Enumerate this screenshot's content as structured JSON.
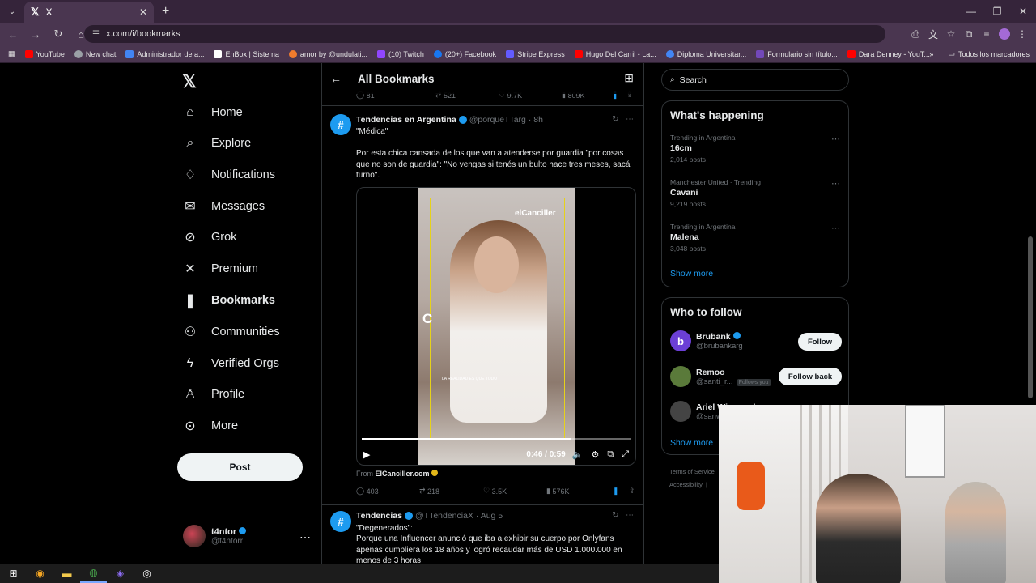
{
  "browser": {
    "tab_title": "X",
    "url": "x.com/i/bookmarks",
    "bookmarks": [
      {
        "label": "YouTube",
        "color": "#ff0000"
      },
      {
        "label": "New chat",
        "color": "#9aa0a6"
      },
      {
        "label": "Administrador de a...",
        "color": "#4285f4"
      },
      {
        "label": "EnBox | Sistema",
        "color": "#ffffff"
      },
      {
        "label": "amor by @undulati...",
        "color": "#f07b2d"
      },
      {
        "label": "(10) Twitch",
        "color": "#9146ff"
      },
      {
        "label": "(20+) Facebook",
        "color": "#1877f2"
      },
      {
        "label": "Stripe Express",
        "color": "#635bff"
      },
      {
        "label": "Hugo Del Carril - La...",
        "color": "#ff0000"
      },
      {
        "label": "Diploma Universitar...",
        "color": "#4285f4"
      },
      {
        "label": "Formulario sin título...",
        "color": "#7248b9"
      },
      {
        "label": "Dara Denney - YouT...",
        "color": "#ff0000"
      }
    ],
    "all_bookmarks": "Todos los marcadores"
  },
  "sidebar": {
    "items": [
      {
        "label": "Home",
        "icon": "⌂"
      },
      {
        "label": "Explore",
        "icon": "⌕"
      },
      {
        "label": "Notifications",
        "icon": "🔔"
      },
      {
        "label": "Messages",
        "icon": "✉"
      },
      {
        "label": "Grok",
        "icon": "⊘"
      },
      {
        "label": "Premium",
        "icon": "✕"
      },
      {
        "label": "Bookmarks",
        "icon": "❚"
      },
      {
        "label": "Communities",
        "icon": "👥"
      },
      {
        "label": "Verified Orgs",
        "icon": "⚡"
      },
      {
        "label": "Profile",
        "icon": "👤"
      },
      {
        "label": "More",
        "icon": "⋯"
      }
    ],
    "post_label": "Post",
    "user": {
      "name": "t4ntor",
      "handle": "@t4ntorr"
    }
  },
  "feed": {
    "title": "All Bookmarks",
    "prev_stats": {
      "replies": "81",
      "reposts": "521",
      "likes": "9.7K",
      "views": "809K"
    },
    "tweet1": {
      "name": "Tendencias en Argentina",
      "handle": "@porqueTTarg",
      "time": "· 8h",
      "line1": "\"Médica\"",
      "body": "Por esta chica cansada de los que van a atenderse por guardia \"por cosas que no son de guardia\": \"No vengas si tenés un bulto hace tres meses, sacá turno\".",
      "video": {
        "watermark": "elCanciller",
        "caption": "LA REALIDAD ES QUE TODO",
        "letter": "C",
        "time": "0:46 / 0:59",
        "progress": 0.78
      },
      "from_label": "From",
      "from_source": "ElCanciller.com",
      "replies": "403",
      "reposts": "218",
      "likes": "3.5K",
      "views": "576K"
    },
    "tweet2": {
      "name": "Tendencias",
      "handle": "@TTendenciaX",
      "time": "· Aug 5",
      "line1": "\"Degenerados\":",
      "body": "Porque una Influencer anunció que iba a exhibir su cuerpo por Onlyfans apenas cumpliera los 18 años y logró recaudar más de USD 1.000.000 en menos de 3 horas"
    }
  },
  "right": {
    "search_placeholder": "Search",
    "whats_happening": "What's happening",
    "trends": [
      {
        "context": "Trending in Argentina",
        "topic": "16cm",
        "count": "2,014 posts"
      },
      {
        "context": "Manchester United · Trending",
        "topic": "Cavani",
        "count": "9,219 posts"
      },
      {
        "context": "Trending in Argentina",
        "topic": "Malena",
        "count": "3,048 posts"
      }
    ],
    "show_more": "Show more",
    "who_to_follow": "Who to follow",
    "follows": [
      {
        "name": "Brubank",
        "handle": "@brubankarg",
        "button": "Follow",
        "color": "#6b3fd6",
        "initial": "b"
      },
      {
        "name": "Remoo",
        "handle": "@santi_r...",
        "badge": "Follows you",
        "button": "Follow back",
        "color": "#5a7a3a",
        "initial": ""
      },
      {
        "name": "Ariel Wisegrad",
        "handle": "@sanw...",
        "color": "#444",
        "initial": ""
      }
    ],
    "footer": "Terms of Service",
    "footer2": "Accessibility",
    "footer_sep": "|"
  }
}
